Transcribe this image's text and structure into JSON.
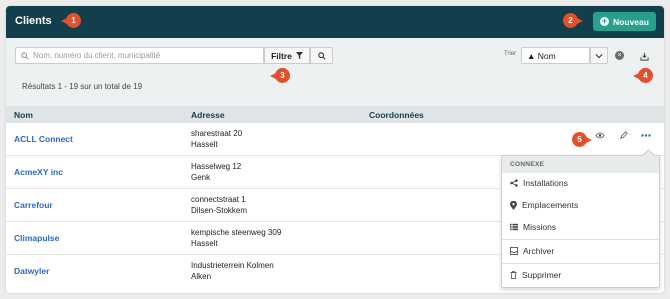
{
  "header": {
    "title": "Clients",
    "new_button": "Nouveau"
  },
  "toolbar": {
    "search_placeholder": "Nom, numéro du client, municipalité",
    "filter_label": "Filtre",
    "sort_label": "Trier",
    "sort_value": "▲ Nom",
    "results_text": "Résultats 1 - 19 sur un total de 19"
  },
  "table": {
    "columns": [
      "Nom",
      "Adresse",
      "Coordonnées"
    ],
    "rows": [
      {
        "name": "ACLL Connect",
        "street": "sharestraat 20",
        "city": "Hasselt"
      },
      {
        "name": "AcmeXY inc",
        "street": "Hasselweg 12",
        "city": "Genk"
      },
      {
        "name": "Carrefour",
        "street": "connectstraat 1",
        "city": "Dilsen-Stokkem"
      },
      {
        "name": "Climapulse",
        "street": "kempische steenweg 309",
        "city": "Hasselt"
      },
      {
        "name": "Datwyler",
        "street": "Industrieterrein Kolmen",
        "city": "Alken"
      }
    ]
  },
  "menu": {
    "header": "CONNEXE",
    "items": [
      "Installations",
      "Emplacements",
      "Missions",
      "Archiver",
      "Supprimer"
    ]
  },
  "markers": [
    "1",
    "2",
    "3",
    "4",
    "5"
  ],
  "colors": {
    "header_bg": "#123f4b",
    "accent": "#27a08e",
    "link": "#2a6bbf",
    "marker": "#e3502b"
  }
}
